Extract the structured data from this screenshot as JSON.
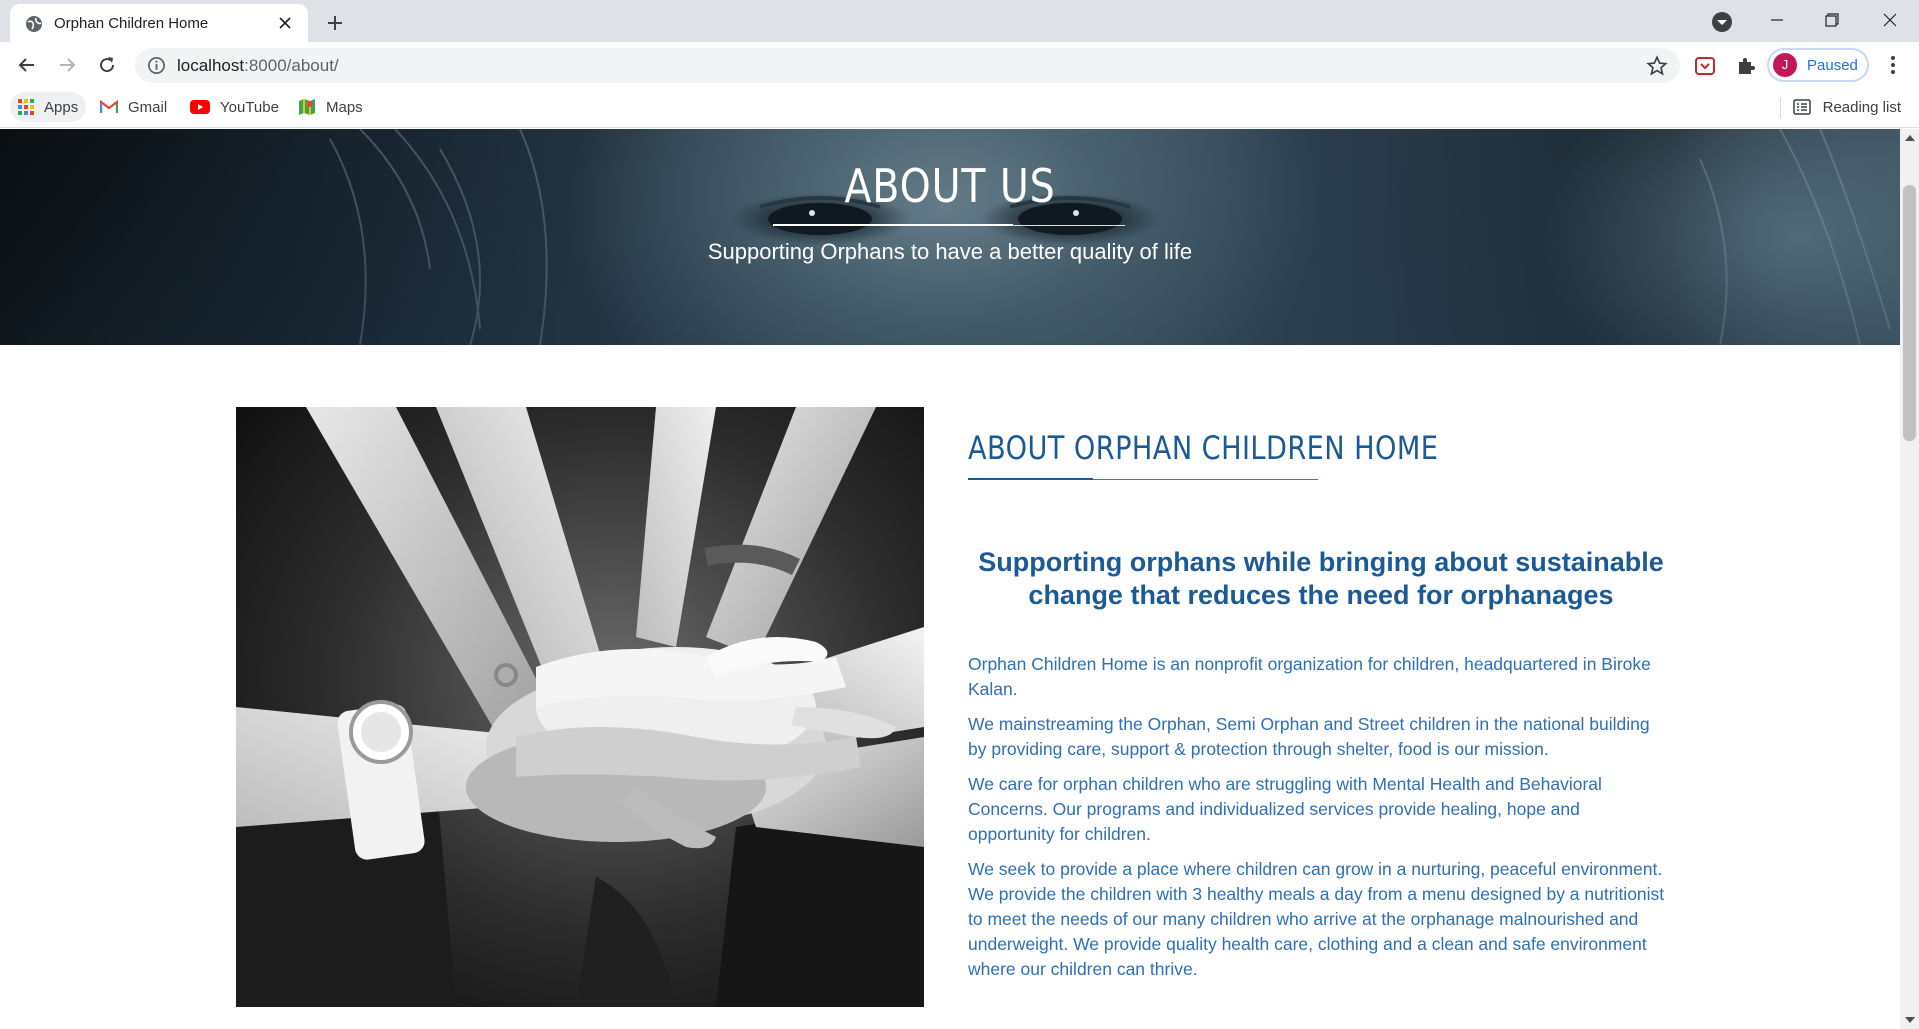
{
  "browser": {
    "tab_title": "Orphan Children Home",
    "url_host": "localhost",
    "url_path": ":8000/about/",
    "profile_initial": "J",
    "profile_status": "Paused",
    "bookmarks": [
      {
        "label": "Apps",
        "icon": "apps-grid-icon"
      },
      {
        "label": "Gmail",
        "icon": "gmail-icon"
      },
      {
        "label": "YouTube",
        "icon": "youtube-icon"
      },
      {
        "label": "Maps",
        "icon": "maps-icon"
      }
    ],
    "reading_list": "Reading list"
  },
  "hero": {
    "title": "ABOUT US",
    "subtitle": "Supporting Orphans to have a better quality of life"
  },
  "about": {
    "heading": "ABOUT ORPHAN CHILDREN HOME",
    "tagline": "Supporting orphans while bringing about sustainable change that reduces the need for orphanages",
    "paragraphs": [
      "Orphan Children Home is an nonprofit organization for children, headquartered in Biroke Kalan.",
      "We mainstreaming the Orphan, Semi Orphan and Street children in the national building by providing care, support & protection through shelter, food is our mission.",
      "We care for orphan children who are struggling with Mental Health and Behavioral Concerns. Our programs and individualized services provide healing, hope and opportunity for children.",
      "We seek to provide a place where children can grow in a nurturing, peaceful environment. We provide the children with 3 healthy meals a day from a menu designed by a nutritionist to meet the needs of our many children who arrive at the orphanage malnourished and underweight. We provide quality health care, clothing and a clean and safe environment where our children can thrive."
    ]
  },
  "colors": {
    "heading_blue": "#1b5a94",
    "text_blue": "#2e6fb5",
    "chrome_bg": "#dee1e6",
    "profile_accent": "#c2185b"
  }
}
